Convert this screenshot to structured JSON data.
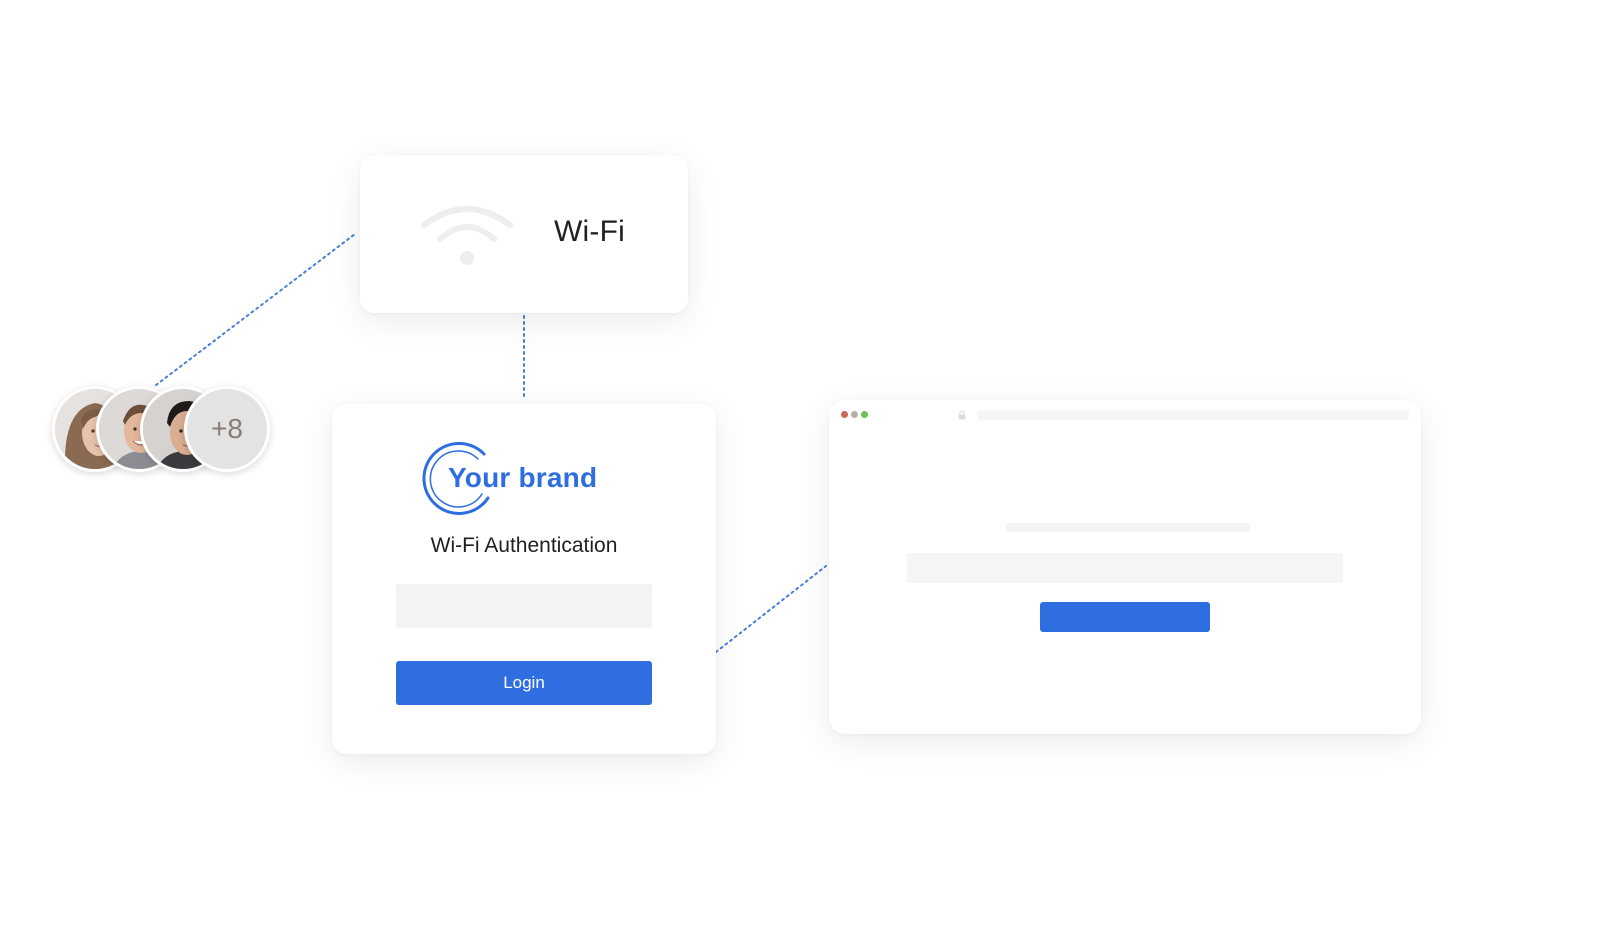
{
  "wifi_card": {
    "label": "Wi-Fi",
    "icon": "wifi-icon"
  },
  "login_card": {
    "brand_name": "Your brand",
    "title": "Wi-Fi Authentication",
    "input_value": "",
    "login_label": "Login"
  },
  "browser_card": {
    "window_controls": [
      "close-dot",
      "minimize-dot",
      "maximize-dot"
    ],
    "lock_icon": "lock-icon"
  },
  "users": {
    "avatars": [
      "avatar-woman",
      "avatar-man-smiling",
      "avatar-man-dark-hair"
    ],
    "more_count": "+8"
  },
  "colors": {
    "accent": "#2e6ee0",
    "connector": "#4a7fd6",
    "placeholder": "#f3f3f3",
    "dot_red": "#c86a5a",
    "dot_yellow": "#b8b0a8",
    "dot_green": "#6cbf5a"
  }
}
